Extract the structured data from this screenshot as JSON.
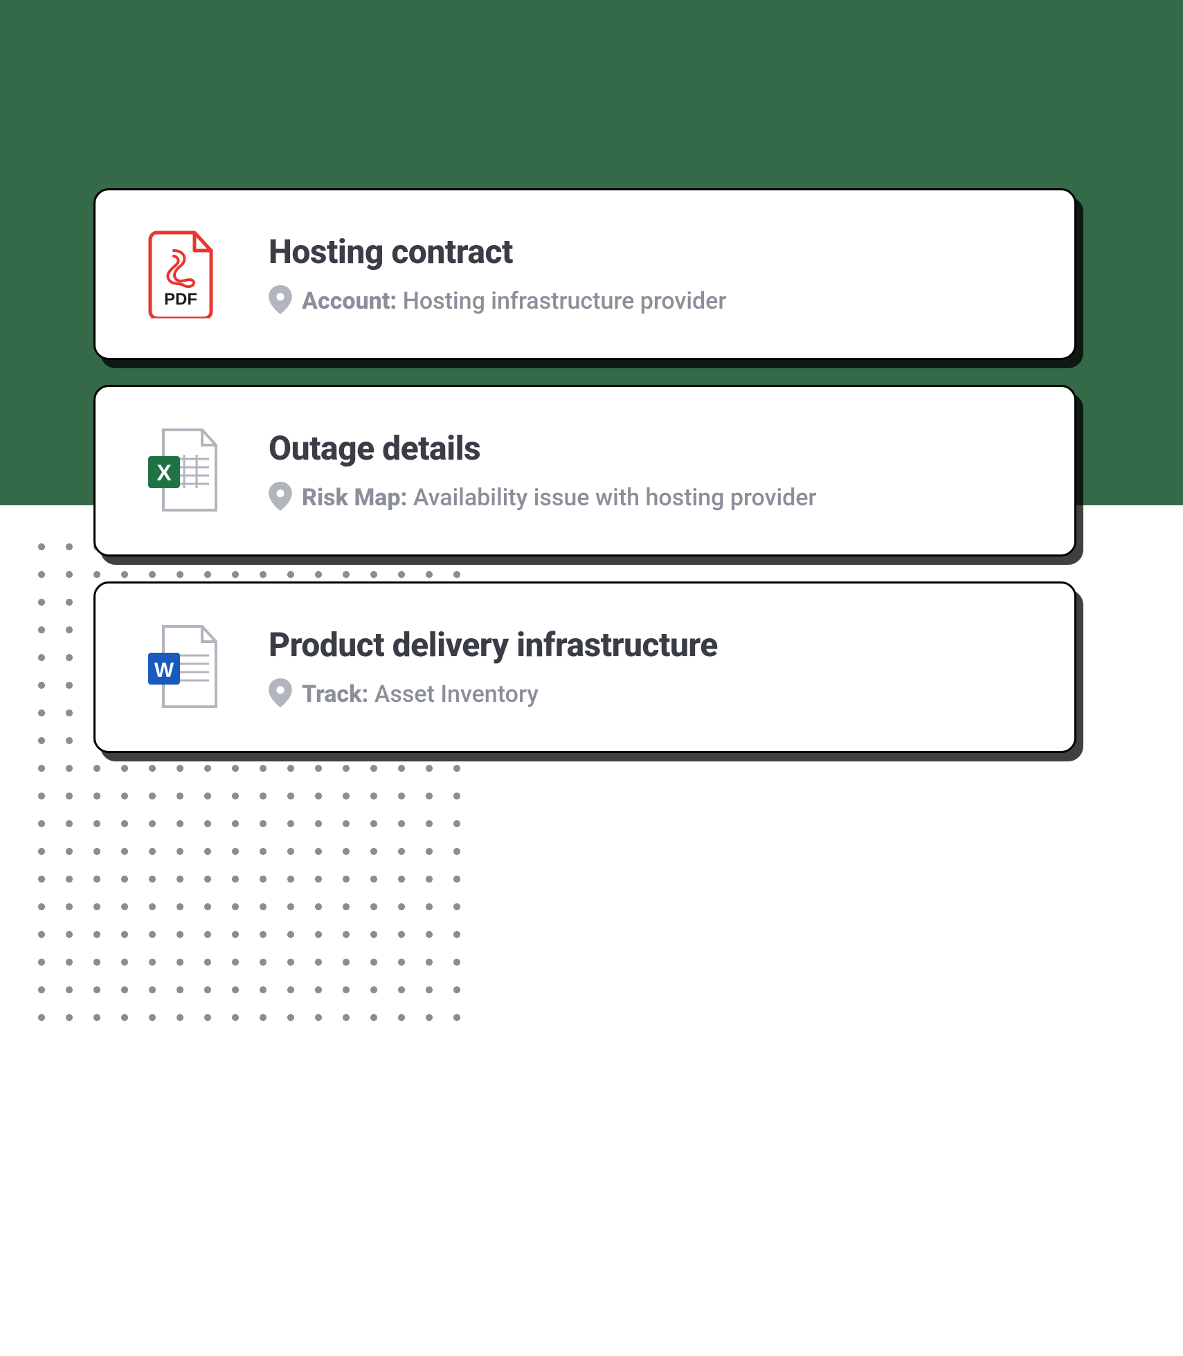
{
  "cards": [
    {
      "icon": "pdf",
      "title": "Hosting contract",
      "label": "Account:",
      "value": "Hosting infrastructure provider"
    },
    {
      "icon": "excel",
      "title": "Outage details",
      "label": "Risk Map:",
      "value": "Availability issue with hosting provider"
    },
    {
      "icon": "word",
      "title": "Product delivery infrastructure",
      "label": "Track:",
      "value": "Asset Inventory"
    }
  ]
}
